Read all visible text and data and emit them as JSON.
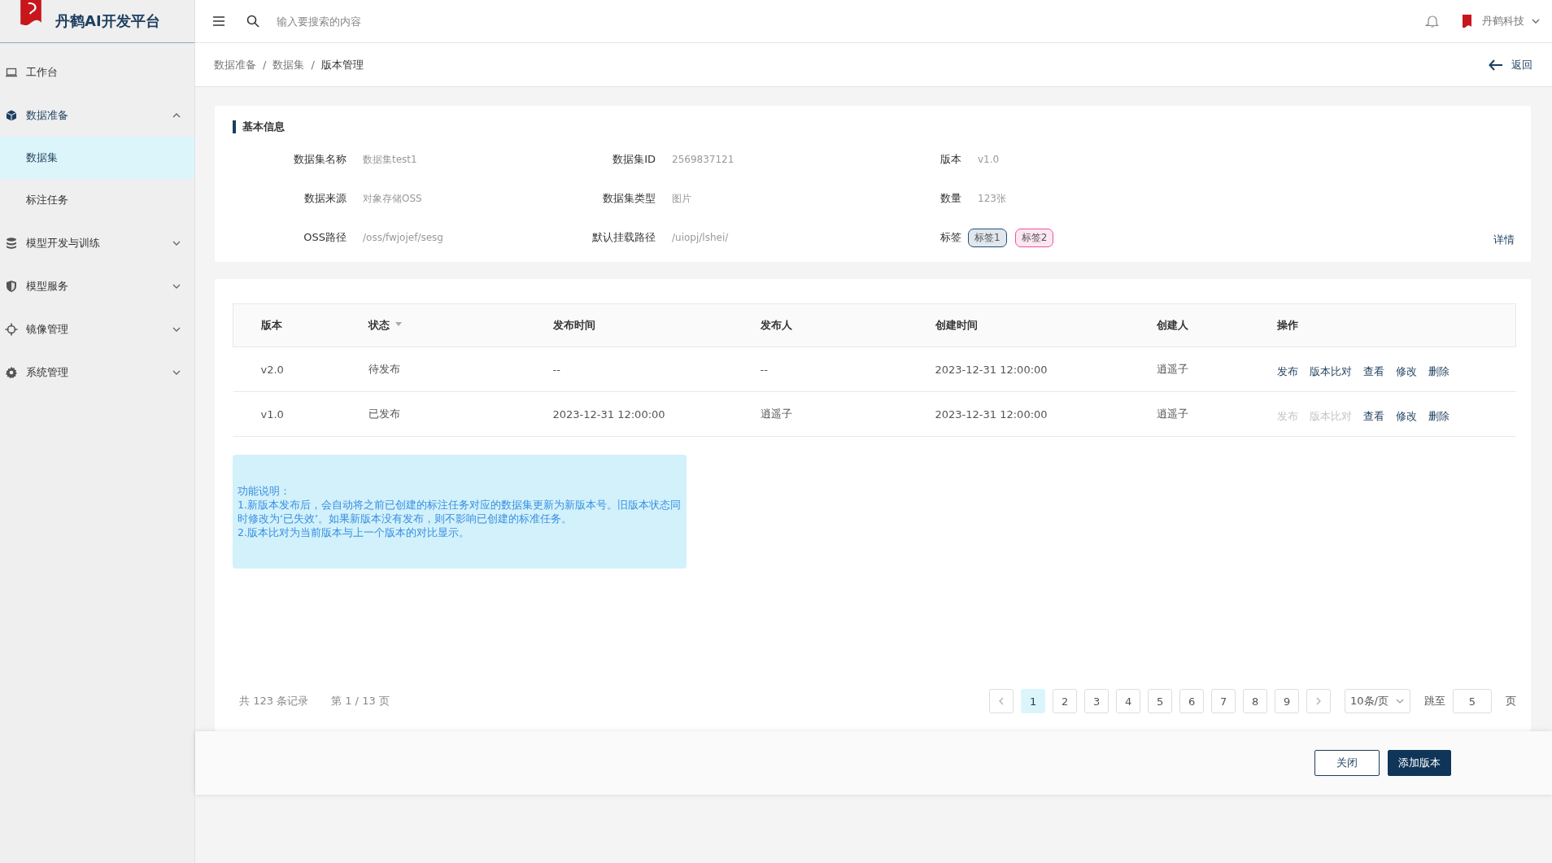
{
  "brand": {
    "name": "丹鹤AI开发平台"
  },
  "topbar": {
    "search_placeholder": "输入要搜索的内容",
    "user": "丹鹤科技"
  },
  "sidebar": {
    "items": [
      {
        "label": "工作台",
        "selected": false
      },
      {
        "label": "数据准备",
        "selected": false,
        "expanded": true,
        "children": [
          {
            "label": "数据集",
            "selected": true
          },
          {
            "label": "标注任务",
            "selected": false
          }
        ]
      },
      {
        "label": "模型开发与训练",
        "selected": false,
        "expanded": false
      },
      {
        "label": "模型服务",
        "selected": false,
        "expanded": false
      },
      {
        "label": "镜像管理",
        "selected": false,
        "expanded": false
      },
      {
        "label": "系统管理",
        "selected": false,
        "expanded": false
      }
    ]
  },
  "breadcrumb": {
    "items": [
      "数据准备",
      "数据集",
      "版本管理"
    ],
    "separators": [
      "/",
      "/"
    ]
  },
  "back_link": "返回",
  "basic_info": {
    "title": "基本信息",
    "fields": [
      {
        "label": "数据集名称",
        "value": "数据集test1"
      },
      {
        "label": "数据集ID",
        "value": "2569837121"
      },
      {
        "label": "版本",
        "value": "v1.0"
      },
      {
        "label": "数据来源",
        "value": "对象存储OSS"
      },
      {
        "label": "数据集类型",
        "value": "图片"
      },
      {
        "label": "数量",
        "value": "123张"
      },
      {
        "label": "OSS路径",
        "value": "/oss/fwjojef/sesg"
      },
      {
        "label": "默认挂载路径",
        "value": "/uiopj/lshei/"
      }
    ],
    "tags_label": "标签",
    "tags": [
      {
        "label": "标签1",
        "color": "#1f4e79"
      },
      {
        "label": "标签2",
        "color": "#f0509e"
      }
    ],
    "details_link": "详情"
  },
  "table": {
    "columns": [
      "版本",
      "状态",
      "发布时间",
      "发布人",
      "创建时间",
      "创建人",
      "操作"
    ],
    "rows": [
      {
        "cells": [
          "v2.0",
          "待发布",
          "--",
          "--",
          "2023-12-31 12:00:00",
          "逍遥子"
        ],
        "actions": [
          {
            "label": "发布",
            "disabled": false
          },
          {
            "label": "版本比对",
            "disabled": false
          },
          {
            "label": "查看",
            "disabled": false
          },
          {
            "label": "修改",
            "disabled": false
          },
          {
            "label": "删除",
            "disabled": false
          }
        ]
      },
      {
        "cells": [
          "v1.0",
          "已发布",
          "2023-12-31 12:00:00",
          "逍遥子",
          "2023-12-31 12:00:00",
          "逍遥子"
        ],
        "actions": [
          {
            "label": "发布",
            "disabled": true
          },
          {
            "label": "版本比对",
            "disabled": true
          },
          {
            "label": "查看",
            "disabled": false
          },
          {
            "label": "修改",
            "disabled": false
          },
          {
            "label": "删除",
            "disabled": false
          }
        ]
      }
    ]
  },
  "note": [
    "功能说明：",
    "1.新版本发布后，会自动将之前已创建的标注任务对应的数据集更新为新版本号。旧版本状态同时修改为‘已失效’。如果新版本没有发布，则不影响已创建的标准任务。",
    "2.版本比对为当前版本与上一个版本的对比显示。"
  ],
  "pagination": {
    "total": "共 123 条记录",
    "page_info": "第 1 / 13 页",
    "pages": [
      {
        "label": "1",
        "selected": true
      },
      {
        "label": "2",
        "selected": false
      },
      {
        "label": "3",
        "selected": false
      },
      {
        "label": "4",
        "selected": false
      },
      {
        "label": "5",
        "selected": false
      },
      {
        "label": "6",
        "selected": false
      },
      {
        "label": "7",
        "selected": false
      },
      {
        "label": "8",
        "selected": false
      },
      {
        "label": "9",
        "selected": false
      }
    ],
    "page_size": "10条/页",
    "jump_label": "跳至",
    "jump_value": "5",
    "jump_suffix": "页"
  },
  "footer_buttons": [
    {
      "label": "关闭",
      "kind": "secondary"
    },
    {
      "label": "添加版本",
      "kind": "primary"
    }
  ]
}
